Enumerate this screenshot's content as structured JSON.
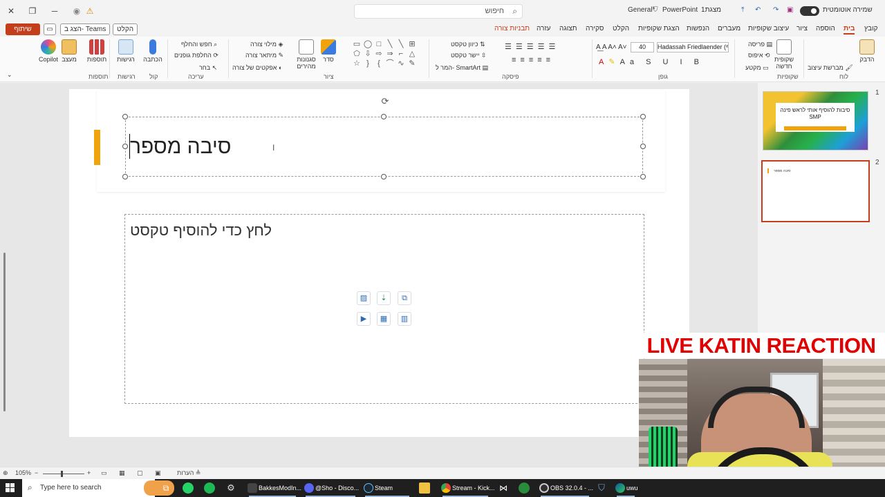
{
  "titlebar": {
    "search_placeholder": "חיפוש",
    "doc_title": "מצגת1",
    "app_name": "PowerPoint",
    "sensitivity": "General*",
    "autosave_label": "שמירה אוטומטית"
  },
  "tabs": {
    "share": "שיתוף",
    "teams": "הצג ב- Teams",
    "record": "הקלט",
    "items": [
      "קובץ",
      "בית",
      "הוספה",
      "ציור",
      "עיצוב שקופיות",
      "מעברים",
      "הנפשות",
      "הצגת שקופיות",
      "הקלט",
      "סקירה",
      "תצוגה",
      "עזרה",
      "תבניות צורה"
    ]
  },
  "ribbon": {
    "copilot": "Copilot",
    "designer": "מעצב",
    "addins": "תוספות",
    "sensitivity": "רגישות",
    "dictate": "הכתבה",
    "find": "חפש והחלף",
    "replace_shapes": "החלפת גופנים",
    "select": "בחר",
    "shape_fill": "מילוי צורה",
    "shape_outline": "מיתאר צורה",
    "shape_effects": "אפקטים של צורה",
    "quick_styles": "סגנונות מהירים",
    "arrange": "סדר",
    "text_direction": "כיוון טקסט",
    "align_text": "יישר טקסט",
    "smartart": "המר ל- SmartArt",
    "font_name": "Hadassah Friedlaender (גוף)",
    "font_size": "40",
    "layout": "פריסה",
    "reset": "איפוס",
    "section": "מקטע",
    "new_slide": "שקופית חדשה",
    "paste": "הדבק",
    "format_painter": "מברשת עיצוב",
    "groups": {
      "addins": "תוספות",
      "sensitivity": "רגישות",
      "voice": "קול",
      "editing": "עריכה",
      "drawing": "ציור",
      "paragraph": "פיסקה",
      "font": "גופן",
      "slides": "שקופיות",
      "clipboard": "לוח"
    }
  },
  "slide": {
    "title": "סיבה מספר",
    "content_placeholder": "לחץ כדי להוסיף טקסט"
  },
  "thumbnails": [
    {
      "number": "1",
      "title": "סיבות להוסיף אותי לראש פינה SMP"
    },
    {
      "number": "2",
      "title": "סיבה מספר"
    }
  ],
  "overlay": {
    "banner": "LIVE KATIN REACTION"
  },
  "statusbar": {
    "zoom": "105%",
    "notes": "הערות"
  },
  "taskbar": {
    "search_placeholder": "Type here to search",
    "apps": [
      {
        "label": "BakkesModIn..."
      },
      {
        "label": "@Sho - Disco..."
      },
      {
        "label": "Steam"
      },
      {
        "label": "Stream - Kick..."
      },
      {
        "label": "OBS 32.0.4 - ..."
      },
      {
        "label": "uwu"
      }
    ]
  }
}
